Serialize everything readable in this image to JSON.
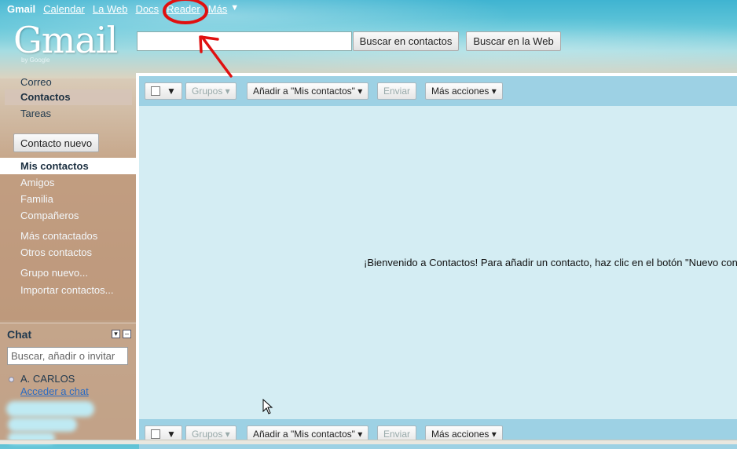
{
  "topnav": {
    "gmail": "Gmail",
    "calendar": "Calendar",
    "web": "La Web",
    "docs": "Docs",
    "reader": "Reader",
    "more": "Más",
    "more_caret": "▼"
  },
  "logo": {
    "text": "Gmail",
    "by_google": "by Google"
  },
  "search": {
    "value": "",
    "search_contacts_label": "Buscar en contactos",
    "search_web_label": "Buscar en la Web"
  },
  "sidebar": {
    "nav": [
      "Correo",
      "Contactos",
      "Tareas"
    ],
    "selected": "Contactos",
    "new_contact_label": "Contacto nuevo",
    "my_contacts": "Mis contactos",
    "groups": [
      "Amigos",
      "Familia",
      "Compañeros"
    ],
    "more_groups": [
      "Más contactados",
      "Otros contactos"
    ],
    "actions": [
      "Grupo nuevo...",
      "Importar contactos..."
    ]
  },
  "chat": {
    "title": "Chat",
    "search_placeholder": "Buscar, añadir o invitar",
    "buddy_name": "A. CARLOS",
    "access_link": "Acceder a chat"
  },
  "toolbar": {
    "groups_label": "Grupos ▾",
    "add_to_label": "Añadir a \"Mis contactos\" ▾",
    "send_label": "Enviar",
    "more_actions_label": "Más acciones ▾",
    "checkbox_caret": "▼"
  },
  "main": {
    "welcome_text": "¡Bienvenido a Contactos! Para añadir un contacto, haz clic en el botón \"Nuevo contacto\""
  },
  "colors": {
    "annotation_red": "#e01010",
    "toolbar_bg": "#9dd1e4",
    "content_bg": "#d4edf3",
    "link_blue": "#2a6bc2"
  }
}
